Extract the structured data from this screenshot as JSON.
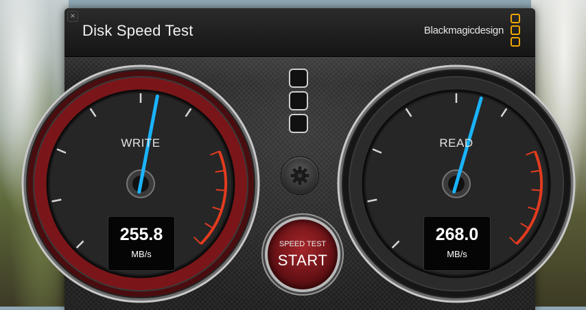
{
  "window": {
    "title": "Disk Speed Test",
    "close_glyph": "×",
    "brand": "Blackmagicdesign"
  },
  "write_gauge": {
    "label": "WRITE",
    "value": "255.8",
    "unit": "MB/s",
    "needle_fraction": 0.54
  },
  "read_gauge": {
    "label": "READ",
    "value": "268.0",
    "unit": "MB/s",
    "needle_fraction": 0.56
  },
  "start_button": {
    "subtitle": "SPEED TEST",
    "label": "START"
  },
  "icons": {
    "settings": "gear-icon",
    "logo": "blackmagic-logo-icon",
    "close": "close-icon"
  },
  "colors": {
    "write_ring": "#8c1a1d",
    "needle": "#1ab4ff",
    "redline": "#e33b1f",
    "brand_accent": "#f0a500"
  }
}
